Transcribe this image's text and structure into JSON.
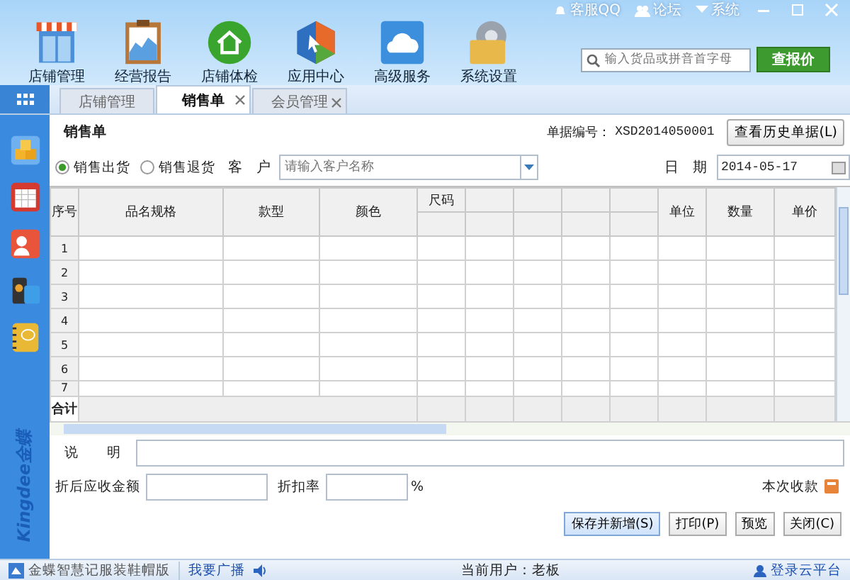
{
  "top_links": [
    {
      "kind": "service",
      "label": "客服QQ"
    },
    {
      "kind": "forum",
      "label": "论坛"
    },
    {
      "kind": "system",
      "label": "系统"
    }
  ],
  "toolbar": [
    {
      "kind": "store",
      "label": "店铺管理"
    },
    {
      "kind": "report",
      "label": "经营报告"
    },
    {
      "kind": "check",
      "label": "店铺体检"
    },
    {
      "kind": "apps",
      "label": "应用中心"
    },
    {
      "kind": "cloud",
      "label": "高级服务"
    },
    {
      "kind": "settings",
      "label": "系统设置"
    }
  ],
  "search": {
    "placeholder": "输入货品或拼音首字母"
  },
  "price_button": "查报价",
  "tabs": [
    {
      "label": "店铺管理",
      "selected": false,
      "closable": false
    },
    {
      "label": "销售单",
      "selected": true,
      "closable": true
    },
    {
      "label": "会员管理",
      "selected": false,
      "closable": true
    }
  ],
  "sidebar": {
    "items": [
      {
        "kind": "boxes"
      },
      {
        "kind": "calendar"
      },
      {
        "kind": "contact"
      },
      {
        "kind": "phone"
      },
      {
        "kind": "notebook"
      }
    ],
    "brand": "Kingdee金蝶"
  },
  "form": {
    "title": "销售单",
    "doc_label": "单据编号：",
    "doc_number": "XSD2014050001",
    "history_button": "查看历史单据(L)",
    "radios": [
      {
        "label": "销售出货",
        "selected": true
      },
      {
        "label": "销售退货",
        "selected": false
      }
    ],
    "customer_label": "客　户",
    "customer_placeholder": "请输入客户名称",
    "date_label": "日　期",
    "date": "2014-05-17"
  },
  "table": {
    "columns": [
      "序号",
      "品名规格",
      "款型",
      "颜色",
      "尺码",
      "",
      "",
      "",
      "",
      "单位",
      "数量",
      "单价"
    ],
    "rows": [
      "1",
      "2",
      "3",
      "4",
      "5",
      "6",
      "7"
    ],
    "total_label": "合计"
  },
  "footer": {
    "note_label": "说　　明",
    "amount_label": "折后应收金额",
    "discount_label": "折扣率",
    "percent": "%",
    "receive_label": "本次收款",
    "buttons": [
      "保存并新增(S)",
      "打印(P)",
      "预览",
      "关闭(C)"
    ]
  },
  "status_bar": {
    "product": "金蝶智慧记服装鞋帽版",
    "broadcast": "我要广播",
    "user": "当前用户：老板",
    "login": "登录云平台"
  }
}
